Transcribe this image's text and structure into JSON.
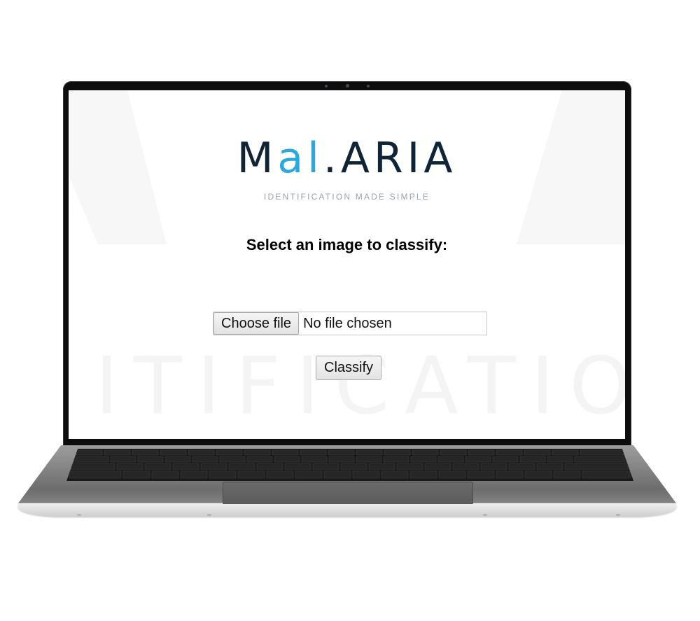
{
  "logo": {
    "part1": "M",
    "part2": "al",
    "part3": ".ARIA",
    "tagline": "IDENTIFICATION MADE SIMPLE",
    "brand_color": "#0f2437",
    "accent_color": "#29a9e0"
  },
  "watermark": {
    "text": "ITIFICATION"
  },
  "form": {
    "heading": "Select an image to classify:",
    "file_button": "Choose file",
    "file_status": "No file chosen",
    "submit_button": "Classify"
  }
}
